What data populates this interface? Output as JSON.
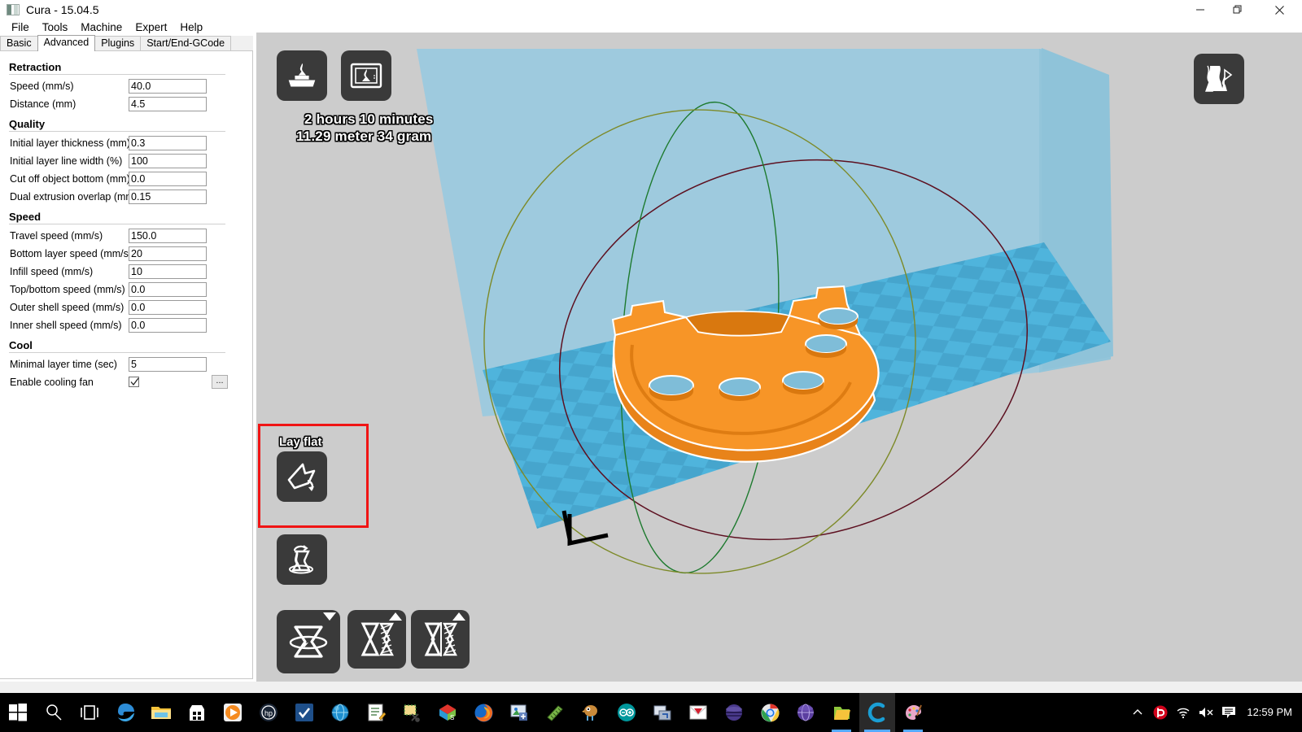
{
  "window": {
    "title": "Cura - 15.04.5",
    "app_icon": "cura-logo-icon",
    "controls": [
      {
        "name": "minimize-button",
        "glyph": "minimize-icon"
      },
      {
        "name": "restore-button",
        "glyph": "restore-icon"
      },
      {
        "name": "close-button",
        "glyph": "close-icon"
      }
    ]
  },
  "menubar": {
    "items": [
      "File",
      "Tools",
      "Machine",
      "Expert",
      "Help"
    ]
  },
  "tabs": {
    "items": [
      "Basic",
      "Advanced",
      "Plugins",
      "Start/End-GCode"
    ],
    "active": "Advanced"
  },
  "settings": {
    "groups": [
      {
        "title": "Retraction",
        "rows": [
          {
            "label": "Speed (mm/s)",
            "value": "40.0",
            "type": "text"
          },
          {
            "label": "Distance (mm)",
            "value": "4.5",
            "type": "text"
          }
        ]
      },
      {
        "title": "Quality",
        "rows": [
          {
            "label": "Initial layer thickness (mm)",
            "value": "0.3",
            "type": "text"
          },
          {
            "label": "Initial layer line width (%)",
            "value": "100",
            "type": "text"
          },
          {
            "label": "Cut off object bottom (mm)",
            "value": "0.0",
            "type": "text"
          },
          {
            "label": "Dual extrusion overlap (mm)",
            "value": "0.15",
            "type": "text"
          }
        ]
      },
      {
        "title": "Speed",
        "rows": [
          {
            "label": "Travel speed (mm/s)",
            "value": "150.0",
            "type": "text"
          },
          {
            "label": "Bottom layer speed (mm/s)",
            "value": "20",
            "type": "text"
          },
          {
            "label": "Infill speed (mm/s)",
            "value": "10",
            "type": "text"
          },
          {
            "label": "Top/bottom speed (mm/s)",
            "value": "0.0",
            "type": "text"
          },
          {
            "label": "Outer shell speed (mm/s)",
            "value": "0.0",
            "type": "text"
          },
          {
            "label": "Inner shell speed (mm/s)",
            "value": "0.0",
            "type": "text"
          }
        ]
      },
      {
        "title": "Cool",
        "rows": [
          {
            "label": "Minimal layer time (sec)",
            "value": "5",
            "type": "text"
          },
          {
            "label": "Enable cooling fan",
            "value": "",
            "type": "checkbox",
            "checked": true,
            "extra_button": "..."
          }
        ]
      }
    ]
  },
  "viewport": {
    "print_time": "2 hours 10 minutes",
    "print_material": "11.29 meter 34 gram",
    "toolbar_top": [
      {
        "name": "load-model-button",
        "icon": "load-model-icon"
      },
      {
        "name": "save-toolpath-button",
        "icon": "save-toolpath-icon"
      }
    ],
    "view_mode_button": {
      "name": "view-mode-button",
      "icon": "view-mode-icon"
    },
    "lay_flat": {
      "label": "Lay flat",
      "icon": "lay-flat-icon",
      "highlighted": true
    },
    "scale_button": {
      "name": "scale-button",
      "icon": "scale-model-icon"
    },
    "bottom_tools": [
      {
        "name": "rotate-button",
        "icon": "rotate-model-icon"
      },
      {
        "name": "mirror-x-button",
        "icon": "mirror-x-icon"
      },
      {
        "name": "mirror-y-button",
        "icon": "mirror-y-icon"
      }
    ],
    "colors": {
      "background": "#cccccc",
      "build_wall": "#9ecade",
      "build_plate": "#4fb4dc",
      "build_plate_alt": "#49a3c8",
      "model": "#f79020",
      "model_outline": "#ffffff",
      "ring_green": "#1d7a2e",
      "ring_olive": "#7f8c2a",
      "ring_red": "#6b1020"
    }
  },
  "taskbar": {
    "start": "start-button",
    "items": [
      {
        "name": "search-icon"
      },
      {
        "name": "task-view-icon"
      },
      {
        "name": "edge-icon"
      },
      {
        "name": "file-explorer-icon"
      },
      {
        "name": "microsoft-store-icon"
      },
      {
        "name": "media-player-icon"
      },
      {
        "name": "hp-support-icon"
      },
      {
        "name": "checkmark-app-icon"
      },
      {
        "name": "globe-app-icon"
      },
      {
        "name": "notepad-icon"
      },
      {
        "name": "snipping-tool-icon"
      },
      {
        "name": "sketchup-icon"
      },
      {
        "name": "firefox-icon"
      },
      {
        "name": "image-app-icon"
      },
      {
        "name": "ruler-app-icon"
      },
      {
        "name": "bird-app-icon"
      },
      {
        "name": "arduino-icon"
      },
      {
        "name": "remote-desktop-icon"
      },
      {
        "name": "mail-icon"
      },
      {
        "name": "purple-sphere-icon"
      },
      {
        "name": "chrome-icon"
      },
      {
        "name": "purple-globe-icon"
      },
      {
        "name": "folder-app-icon",
        "open": true
      },
      {
        "name": "cura-icon",
        "active": true
      },
      {
        "name": "paint-icon",
        "open": true
      }
    ],
    "tray": [
      {
        "name": "show-hidden-icons-chevron"
      },
      {
        "name": "beats-audio-icon"
      },
      {
        "name": "wifi-icon"
      },
      {
        "name": "volume-muted-icon"
      },
      {
        "name": "notifications-icon"
      }
    ],
    "clock": "12:59 PM"
  }
}
